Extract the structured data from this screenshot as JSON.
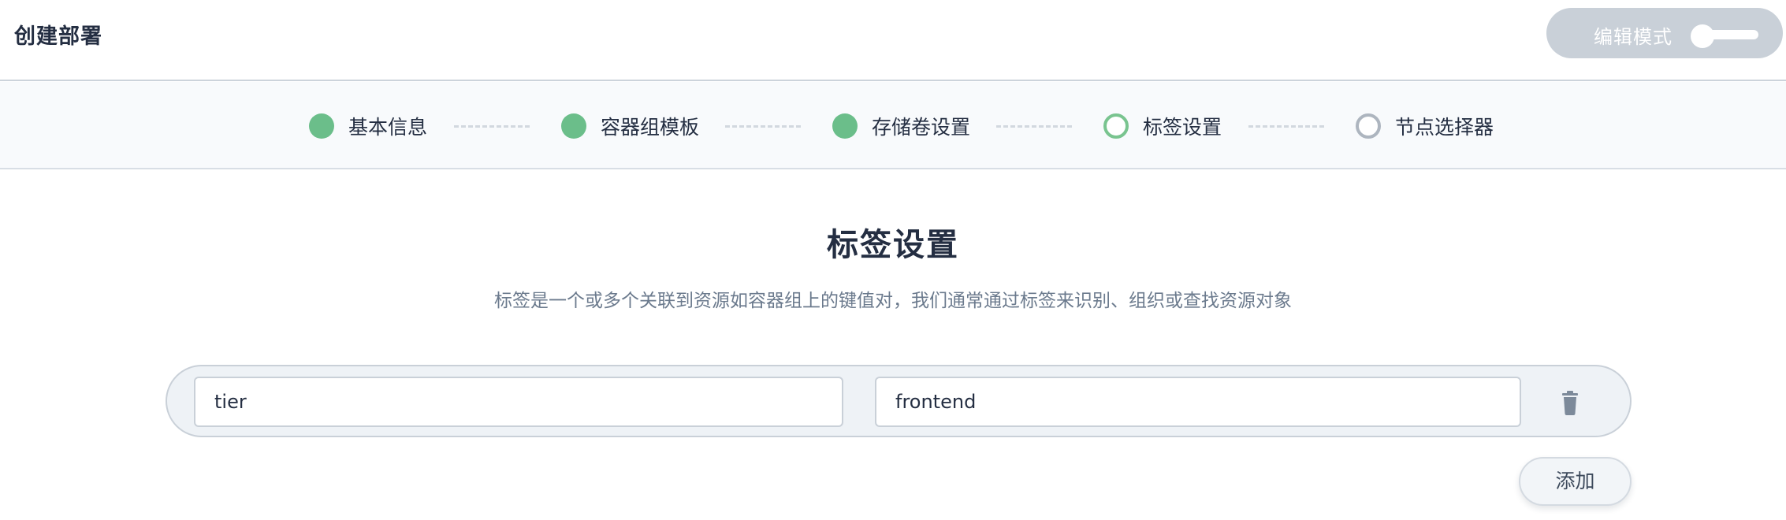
{
  "header": {
    "title": "创建部署",
    "edit_mode_label": "编辑模式"
  },
  "steps": [
    {
      "label": "基本信息",
      "status": "done"
    },
    {
      "label": "容器组模板",
      "status": "done"
    },
    {
      "label": "存储卷设置",
      "status": "done"
    },
    {
      "label": "标签设置",
      "status": "current"
    },
    {
      "label": "节点选择器",
      "status": "pending"
    }
  ],
  "main": {
    "title": "标签设置",
    "description": "标签是一个或多个关联到资源如容器组上的键值对，我们通常通过标签来识别、组织或查找资源对象",
    "labels": [
      {
        "key": "tier",
        "value": "frontend"
      }
    ],
    "add_label": "添加"
  },
  "colors": {
    "done": "#6bbe8a",
    "current": "#79c48f",
    "pending": "#adb5bf"
  }
}
